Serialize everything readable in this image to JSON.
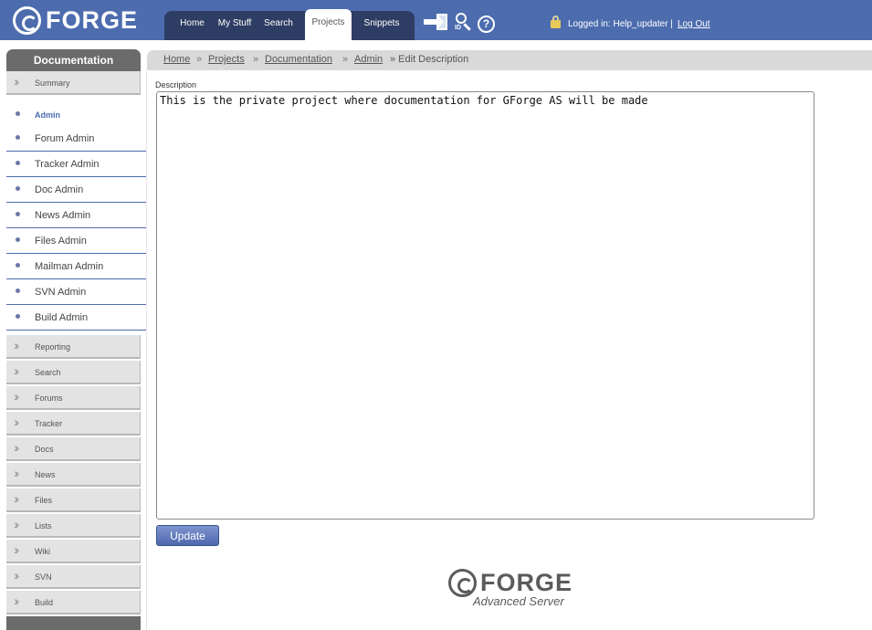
{
  "header": {
    "logo": "FORGE",
    "nav": [
      {
        "label": "Home",
        "active": false
      },
      {
        "label": "My Stuff",
        "active": false
      },
      {
        "label": "Search",
        "active": false
      },
      {
        "label": "Projects",
        "active": true
      },
      {
        "label": "Snippets",
        "active": false
      }
    ],
    "icons": [
      "login-icon",
      "search-id-icon",
      "help-icon",
      "lock-icon"
    ],
    "search_icon_text": "ID",
    "help_icon_text": "?",
    "login_info": "Logged in: Help_updater |",
    "logout": "Log Out"
  },
  "sidebar": {
    "title": "Documentation",
    "summary": "Summary",
    "admin_items": [
      "Admin",
      "Forum Admin",
      "Tracker Admin",
      "Doc Admin",
      "News Admin",
      "Files Admin",
      "Mailman Admin",
      "SVN Admin",
      "Build Admin"
    ],
    "tools": [
      "Reporting",
      "Search",
      "Forums",
      "Tracker",
      "Docs",
      "News",
      "Files",
      "Lists",
      "Wiki",
      "SVN",
      "Build"
    ]
  },
  "breadcrumb": {
    "items": [
      "Home",
      "Projects",
      "Documentation",
      "Admin"
    ],
    "separator": "»",
    "current": "» Edit Description"
  },
  "form": {
    "label": "Description",
    "value": "This is the private project where documentation for GForge AS will be made",
    "button": "Update"
  },
  "footer": {
    "logo": "FORGE",
    "subtitle": "Advanced Server"
  },
  "colors": {
    "topbar": "#4c6cae",
    "navbar": "#2d3d63",
    "sidebar_title": "#6b6b6b",
    "sidebar_item": "#e3e3e3",
    "breadcrumb_bar": "#d9d9d9"
  }
}
